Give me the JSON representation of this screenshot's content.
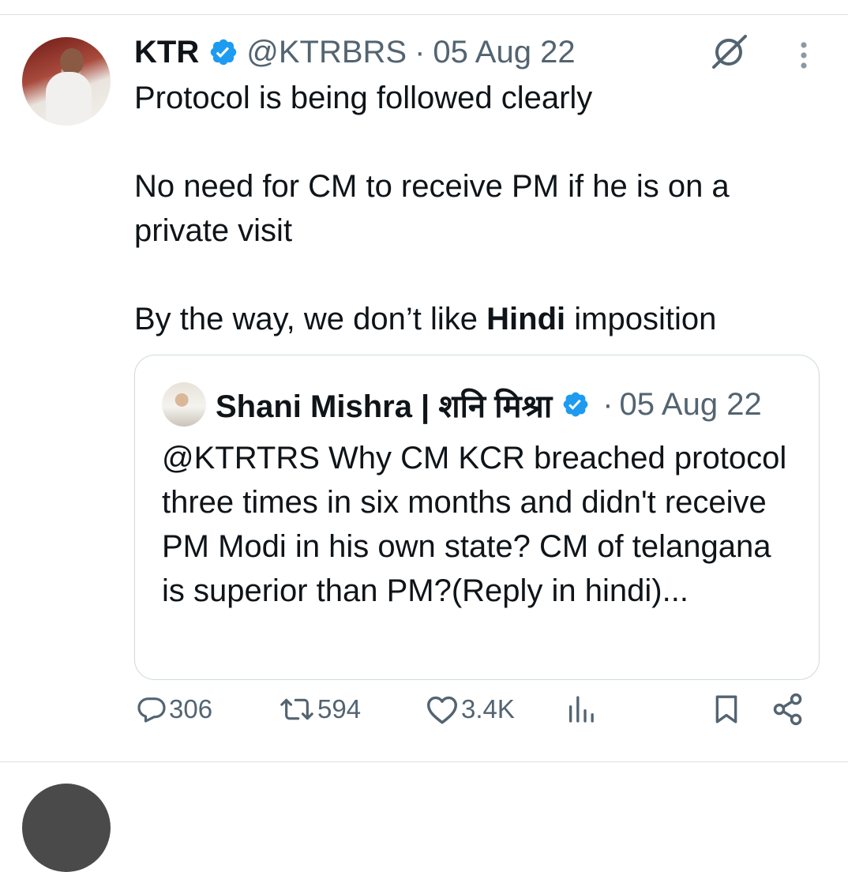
{
  "tweet": {
    "author_name": "KTR",
    "handle": "@KTRBRS",
    "separator": "·",
    "date": "05 Aug 22",
    "paragraphs": [
      "Protocol is being followed clearly",
      "No need for CM to receive PM if he is on a private visit"
    ],
    "last_para_before": "By the way, we don’t like ",
    "last_para_bold": "Hindi",
    "last_para_after": " imposition"
  },
  "quoted": {
    "author_name": "Shani Mishra | शनि मिश्रा",
    "separator": "·",
    "date": "05 Aug 22",
    "text": "@KTRTRS Why CM KCR breached protocol three times in six months and didn't receive PM Modi in his own state? CM of telangana is superior than PM?(Reply in hindi)..."
  },
  "actions": {
    "replies": "306",
    "retweets": "594",
    "likes": "3.4K"
  },
  "colors": {
    "verified": "#1d9bf0",
    "muted": "#536471",
    "text": "#0f1419",
    "border": "#cfd9de"
  },
  "icons": [
    "grok-icon",
    "more-icon",
    "verified-badge-icon",
    "reply-icon",
    "retweet-icon",
    "like-icon",
    "views-icon",
    "bookmark-icon",
    "share-icon"
  ]
}
